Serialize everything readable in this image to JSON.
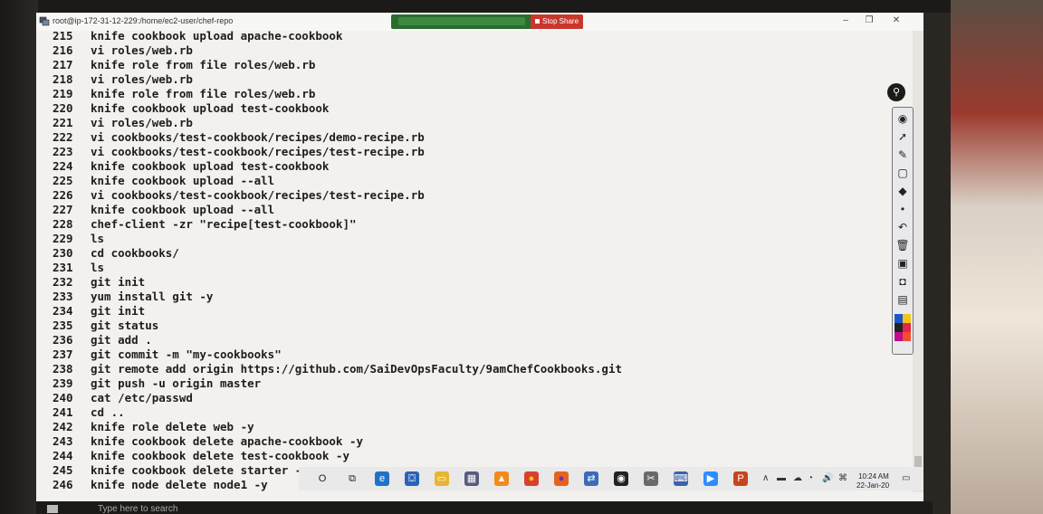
{
  "window": {
    "title": "root@ip-172-31-12-229:/home/ec2-user/chef-repo",
    "stop_share": "Stop Share",
    "minimize": "–",
    "restore": "❐",
    "close": "✕"
  },
  "terminal": {
    "lines": [
      {
        "num": "215",
        "cmd": "knife cookbook upload apache-cookbook"
      },
      {
        "num": "216",
        "cmd": "vi roles/web.rb"
      },
      {
        "num": "217",
        "cmd": "knife role from file roles/web.rb"
      },
      {
        "num": "218",
        "cmd": "vi roles/web.rb"
      },
      {
        "num": "219",
        "cmd": "knife role from file roles/web.rb"
      },
      {
        "num": "220",
        "cmd": "knife cookbook upload test-cookbook"
      },
      {
        "num": "221",
        "cmd": "vi roles/web.rb"
      },
      {
        "num": "222",
        "cmd": "vi cookbooks/test-cookbook/recipes/demo-recipe.rb"
      },
      {
        "num": "223",
        "cmd": "vi cookbooks/test-cookbook/recipes/test-recipe.rb"
      },
      {
        "num": "224",
        "cmd": "knife cookbook upload test-cookbook"
      },
      {
        "num": "225",
        "cmd": "knife cookbook upload --all"
      },
      {
        "num": "226",
        "cmd": "vi cookbooks/test-cookbook/recipes/test-recipe.rb"
      },
      {
        "num": "227",
        "cmd": "knife cookbook upload --all"
      },
      {
        "num": "228",
        "cmd": "chef-client -zr \"recipe[test-cookbook]\""
      },
      {
        "num": "229",
        "cmd": "ls"
      },
      {
        "num": "230",
        "cmd": "cd cookbooks/"
      },
      {
        "num": "231",
        "cmd": "ls"
      },
      {
        "num": "232",
        "cmd": "git init"
      },
      {
        "num": "233",
        "cmd": "yum install git -y"
      },
      {
        "num": "234",
        "cmd": "git init"
      },
      {
        "num": "235",
        "cmd": "git status"
      },
      {
        "num": "236",
        "cmd": "git add ."
      },
      {
        "num": "237",
        "cmd": "git commit -m \"my-cookbooks\""
      },
      {
        "num": "238",
        "cmd": "git remote add origin https://github.com/SaiDevOpsFaculty/9amChefCookbooks.git"
      },
      {
        "num": "239",
        "cmd": "git push -u origin master"
      },
      {
        "num": "240",
        "cmd": "cat /etc/passwd"
      },
      {
        "num": "241",
        "cmd": "cd .."
      },
      {
        "num": "242",
        "cmd": "knife role delete web -y"
      },
      {
        "num": "243",
        "cmd": "knife cookbook delete apache-cookbook -y"
      },
      {
        "num": "244",
        "cmd": "knife cookbook delete test-cookbook -y"
      },
      {
        "num": "245",
        "cmd": "knife cookbook delete starter -y"
      },
      {
        "num": "246",
        "cmd": "knife node delete node1 -y"
      }
    ]
  },
  "annotation_tools": [
    {
      "icon": "eye-icon",
      "glyph": "◉"
    },
    {
      "icon": "pointer-icon",
      "glyph": "➚"
    },
    {
      "icon": "pen-icon",
      "glyph": "✎"
    },
    {
      "icon": "shape-icon",
      "glyph": "▢"
    },
    {
      "icon": "eraser-icon",
      "glyph": "◆"
    },
    {
      "icon": "dot-icon",
      "glyph": "•"
    },
    {
      "icon": "undo-icon",
      "glyph": "↶"
    },
    {
      "icon": "trash-icon",
      "glyph": "🗑"
    },
    {
      "icon": "stamp-icon",
      "glyph": "▣"
    },
    {
      "icon": "camera-icon",
      "glyph": "◘"
    },
    {
      "icon": "clipboard-icon",
      "glyph": "▤"
    }
  ],
  "colors": {
    "swatches": [
      "#1f57c9",
      "#f0c418",
      "#222222",
      "#e0284a",
      "#c20a8d",
      "#f24f2f"
    ],
    "stop_share": "#c9372c",
    "share_bar": "#2c6b2f"
  },
  "taskbar": {
    "search_placeholder": "Type here to search",
    "time": "10:24 AM",
    "date": "22-Jan-20",
    "apps": [
      {
        "name": "cortana-icon",
        "glyph": "O",
        "color": "#e9e9ea",
        "fg": "#222"
      },
      {
        "name": "task-view-icon",
        "glyph": "⧉",
        "color": "#e9e9ea",
        "fg": "#222"
      },
      {
        "name": "edge-icon",
        "glyph": "e",
        "color": "#1e73c8",
        "fg": "#fff"
      },
      {
        "name": "store-icon",
        "glyph": "⛋",
        "color": "#2b62b8",
        "fg": "#fff"
      },
      {
        "name": "file-explorer-icon",
        "glyph": "▭",
        "color": "#e8b533",
        "fg": "#fff"
      },
      {
        "name": "calculator-icon",
        "glyph": "▦",
        "color": "#5a5a7a",
        "fg": "#fff"
      },
      {
        "name": "vlc-icon",
        "glyph": "▲",
        "color": "#f18a1a",
        "fg": "#fff"
      },
      {
        "name": "chrome-icon",
        "glyph": "●",
        "color": "#d8412f",
        "fg": "#f6c90e"
      },
      {
        "name": "firefox-icon",
        "glyph": "●",
        "color": "#e5631e",
        "fg": "#6b2cc4"
      },
      {
        "name": "remote-desktop-icon",
        "glyph": "⇄",
        "color": "#3b6bb8",
        "fg": "#fff"
      },
      {
        "name": "maps-icon",
        "glyph": "◉",
        "color": "#222",
        "fg": "#fff"
      },
      {
        "name": "snip-icon",
        "glyph": "✂",
        "color": "#6a6a6a",
        "fg": "#fff"
      },
      {
        "name": "putty-icon",
        "glyph": "⌨",
        "color": "#3d62a8",
        "fg": "#fff"
      },
      {
        "name": "zoom-icon",
        "glyph": "▶",
        "color": "#2d8cff",
        "fg": "#fff"
      },
      {
        "name": "powerpoint-icon",
        "glyph": "P",
        "color": "#c8441e",
        "fg": "#fff"
      }
    ]
  }
}
